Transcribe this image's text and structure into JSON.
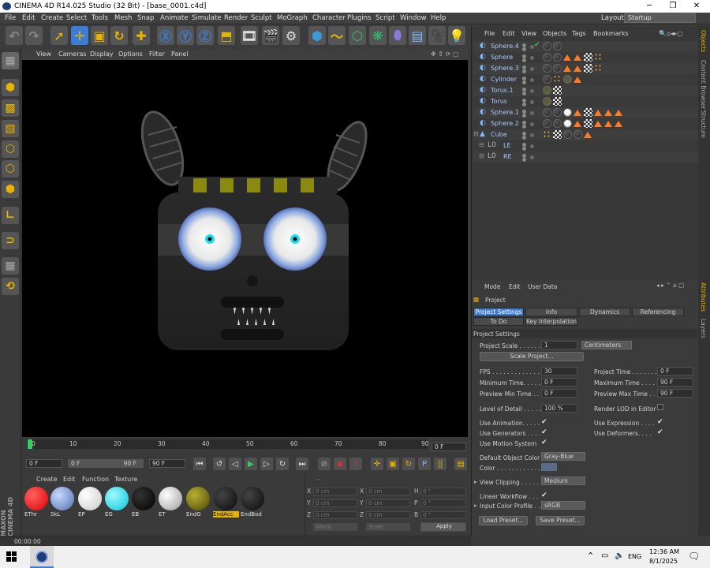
{
  "window": {
    "title": "CINEMA 4D R14.025 Studio (32 Bit) - [base_0001.c4d]",
    "minimize": "─",
    "maximize": "❐",
    "close": "✕"
  },
  "menubar": [
    "File",
    "Edit",
    "Create",
    "Select",
    "Tools",
    "Mesh",
    "Snap",
    "Animate",
    "Simulate",
    "Render",
    "Sculpt",
    "MoGraph",
    "Character",
    "Plugins",
    "Script",
    "Window",
    "Help"
  ],
  "layout": {
    "label": "Layout:",
    "value": "Startup"
  },
  "viewport": {
    "menu": [
      "View",
      "Cameras",
      "Display",
      "Options",
      "Filter",
      "Panel"
    ]
  },
  "timeline": {
    "ticks": [
      "0",
      "10",
      "20",
      "30",
      "40",
      "50",
      "60",
      "70",
      "80",
      "90"
    ],
    "current_frame": "0 F"
  },
  "transport": {
    "start": "0 F",
    "range_start": "0 F",
    "range_end": "90 F",
    "end": "90 F"
  },
  "materials": {
    "menu": [
      "Create",
      "Edit",
      "Function",
      "Texture"
    ],
    "items": [
      {
        "label": "EThr",
        "color": "#ff1010"
      },
      {
        "label": "SkL",
        "color": "#7a9ad8"
      },
      {
        "label": "EP",
        "color": "#f4f4f4"
      },
      {
        "label": "EG",
        "color": "#19e6f0"
      },
      {
        "label": "EB",
        "color": "#050505"
      },
      {
        "label": "ET",
        "color": "#e8e8e8"
      },
      {
        "label": "EndG",
        "color": "#7a7410"
      },
      {
        "label": "EndAcc",
        "color": "#151515"
      },
      {
        "label": "EndBod",
        "color": "#1b1b1b"
      }
    ],
    "brand": "MAXON CINEMA 4D"
  },
  "coordinates": {
    "rows": [
      {
        "a": "X",
        "av": "0 cm",
        "b": "X",
        "bv": "0 cm",
        "c": "H",
        "cv": "0 °"
      },
      {
        "a": "Y",
        "av": "0 cm",
        "b": "Y",
        "bv": "0 cm",
        "c": "P",
        "cv": "0 °"
      },
      {
        "a": "Z",
        "av": "0 cm",
        "b": "Z",
        "bv": "0 cm",
        "c": "B",
        "cv": "0 °"
      }
    ],
    "mode1": "World",
    "mode2": "Scale",
    "apply": "Apply"
  },
  "status": {
    "time": "00:00:00"
  },
  "objects": {
    "menu": [
      "File",
      "Edit",
      "View",
      "Objects",
      "Tags",
      "Bookmarks"
    ],
    "items": [
      {
        "name": "Sphere.4",
        "tags": [
          "#222",
          "#222"
        ]
      },
      {
        "name": "Sphere",
        "tags": [
          "#222",
          "#222",
          "tri",
          "tri",
          "chk",
          "tex"
        ]
      },
      {
        "name": "Sphere.3",
        "tags": [
          "#222",
          "#222",
          "tri",
          "tri",
          "chk",
          "tex"
        ]
      },
      {
        "name": "Cylinder",
        "tags": [
          "#222",
          "tex",
          "#6a6a10",
          "tri"
        ]
      },
      {
        "name": "Torus.1",
        "tags": [
          "#6a6a10",
          "chk"
        ]
      },
      {
        "name": "Torus",
        "tags": [
          "#6a6a10",
          "chk"
        ]
      },
      {
        "name": "Sphere.1",
        "tags": [
          "#222",
          "#222",
          "#ddd",
          "tri",
          "chk",
          "tri",
          "tri",
          "tri"
        ]
      },
      {
        "name": "Sphere.2",
        "tags": [
          "#222",
          "#222",
          "#ddd",
          "tri",
          "chk",
          "tri",
          "tri",
          "tri"
        ]
      },
      {
        "name": "Cube",
        "tags": [
          "tex",
          "chk",
          "#222",
          "#222",
          "tri"
        ]
      },
      {
        "name": "LE",
        "tags": []
      },
      {
        "name": "RE",
        "tags": []
      }
    ]
  },
  "attributes": {
    "menu": [
      "Mode",
      "Edit",
      "User Data"
    ],
    "header": "Project",
    "tabs": [
      "Project Settings",
      "Info",
      "Dynamics",
      "Referencing"
    ],
    "tabs2": [
      "To Do",
      "Key Interpolation"
    ],
    "section": "Project Settings",
    "project_scale_label": "Project Scale . . . . . .",
    "project_scale": "1",
    "units": "Centimeters",
    "scale_project": "Scale Project...",
    "fps_label": "FPS . . . . . . . . . . . . . . .",
    "fps": "30",
    "project_time_label": "Project Time . . . . . . .",
    "project_time": "0 F",
    "min_time_label": "Minimum Time. . . . . . .",
    "min_time": "0 F",
    "max_time_label": "Maximum Time . . . . .",
    "max_time": "90 F",
    "prev_min_label": "Preview Min Time . .",
    "prev_min": "0 F",
    "prev_max_label": "Preview Max Time . .",
    "prev_max": "90 F",
    "lod_label": "Level of Detail . . . . .",
    "lod": "100 %",
    "render_lod_label": "Render LOD in Editor",
    "use_animation": "Use Animation. . . . .",
    "use_expression": "Use Expression . . . .",
    "use_generators": "Use Generators . . . .",
    "use_deformers": "Use Deformers. . . .",
    "use_motion": "Use Motion System",
    "default_color_label": "Default Object Color",
    "default_color": "Gray-Blue",
    "color_label": "Color . . . . . . . . . . . . .",
    "view_clipping_label": "View Clipping . . . . .",
    "view_clipping": "Medium",
    "linear_workflow": "Linear Workflow . . .",
    "input_profile_label": "Input Color Profile . .",
    "input_profile": "sRGB",
    "load_preset": "Load Preset...",
    "save_preset": "Save Preset..."
  },
  "side_tabs": {
    "objects": "Objects",
    "content": "Content Browser",
    "structure": "Structure",
    "attributes": "Attributes",
    "layers": "Layers"
  },
  "taskbar": {
    "lang": "ENG",
    "time": "12:36 AM",
    "date": "8/1/2025",
    "up_arrow": "⌃"
  },
  "colors": {
    "accent_yellow": "#e8b400",
    "accent_blue": "#3d7bd8",
    "eye_cyan": "#17e0f0"
  }
}
